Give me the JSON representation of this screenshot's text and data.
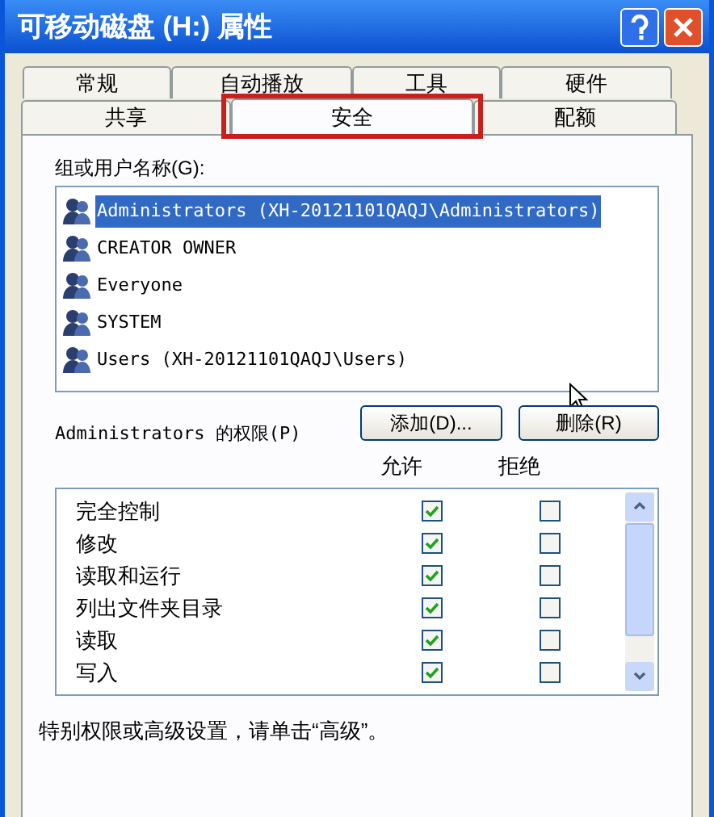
{
  "window": {
    "title": "可移动磁盘 (H:) 属性"
  },
  "tabs_back": [
    {
      "label": "常规",
      "selected": false
    },
    {
      "label": "自动播放",
      "selected": false
    },
    {
      "label": "工具",
      "selected": false
    },
    {
      "label": "硬件",
      "selected": false
    }
  ],
  "tabs_front": [
    {
      "label": "共享",
      "selected": false,
      "highlighted": false
    },
    {
      "label": "安全",
      "selected": true,
      "highlighted": true
    },
    {
      "label": "配额",
      "selected": false,
      "highlighted": false
    }
  ],
  "groups_label": "组或用户名称(G):",
  "groups": [
    {
      "name": "Administrators (XH-20121101QAQJ\\Administrators)",
      "selected": true
    },
    {
      "name": "CREATOR OWNER",
      "selected": false
    },
    {
      "name": "Everyone",
      "selected": false
    },
    {
      "name": "SYSTEM",
      "selected": false
    },
    {
      "name": "Users (XH-20121101QAQJ\\Users)",
      "selected": false
    }
  ],
  "buttons": [
    "添加(D)...",
    "删除(R)"
  ],
  "permissions_label": "Administrators 的权限(P)",
  "columns": [
    "允许",
    "拒绝"
  ],
  "permissions": [
    {
      "name": "完全控制",
      "allow": true,
      "deny": false
    },
    {
      "name": "修改",
      "allow": true,
      "deny": false
    },
    {
      "name": "读取和运行",
      "allow": true,
      "deny": false
    },
    {
      "name": "列出文件夹目录",
      "allow": true,
      "deny": false
    },
    {
      "name": "读取",
      "allow": true,
      "deny": false
    },
    {
      "name": "写入",
      "allow": true,
      "deny": false
    }
  ],
  "footer": "特别权限或高级设置，请单击“高级”。"
}
